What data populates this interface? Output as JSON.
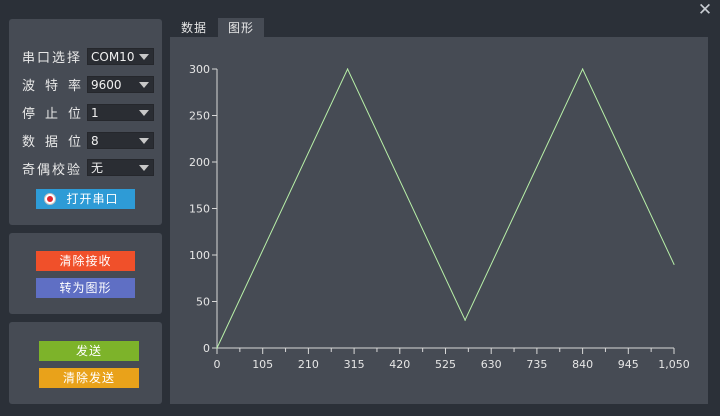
{
  "window": {
    "close_glyph": "✕"
  },
  "serial": {
    "port_label": "串口选择",
    "port_value": "COM10",
    "baud_label": "波特率",
    "baud_value": "9600",
    "stop_label": "停止位",
    "stop_value": "1",
    "data_label": "数据位",
    "data_value": "8",
    "parity_label": "奇偶校验",
    "parity_value": "无",
    "open_button": "打开串口",
    "status_icon": "radio-record-icon"
  },
  "receive": {
    "clear_button": "清除接收",
    "to_graph_button": "转为图形"
  },
  "send": {
    "send_button": "发送",
    "clear_send_button": "清除发送"
  },
  "tabs": [
    {
      "label": "数据",
      "active": false
    },
    {
      "label": "图形",
      "active": true
    }
  ],
  "colors": {
    "clear_receive": "#f0502a",
    "to_graph": "#5f6fc4",
    "send": "#7db32a",
    "clear_send": "#e9a21a",
    "open_port": "#2e9bd6",
    "line": "#b8f0a8"
  },
  "chart_data": {
    "type": "line",
    "title": "",
    "xlabel": "",
    "ylabel": "",
    "xlim": [
      0,
      1050
    ],
    "ylim": [
      0,
      300
    ],
    "x_ticks": [
      "0",
      "105",
      "210",
      "315",
      "420",
      "525",
      "630",
      "735",
      "840",
      "945",
      "1,050"
    ],
    "y_ticks": [
      "0",
      "50",
      "100",
      "150",
      "200",
      "250",
      "300"
    ],
    "grid": false,
    "series": [
      {
        "name": "",
        "x": [
          0,
          300,
          570,
          840,
          1050
        ],
        "y": [
          0,
          300,
          30,
          300,
          90
        ]
      }
    ]
  }
}
